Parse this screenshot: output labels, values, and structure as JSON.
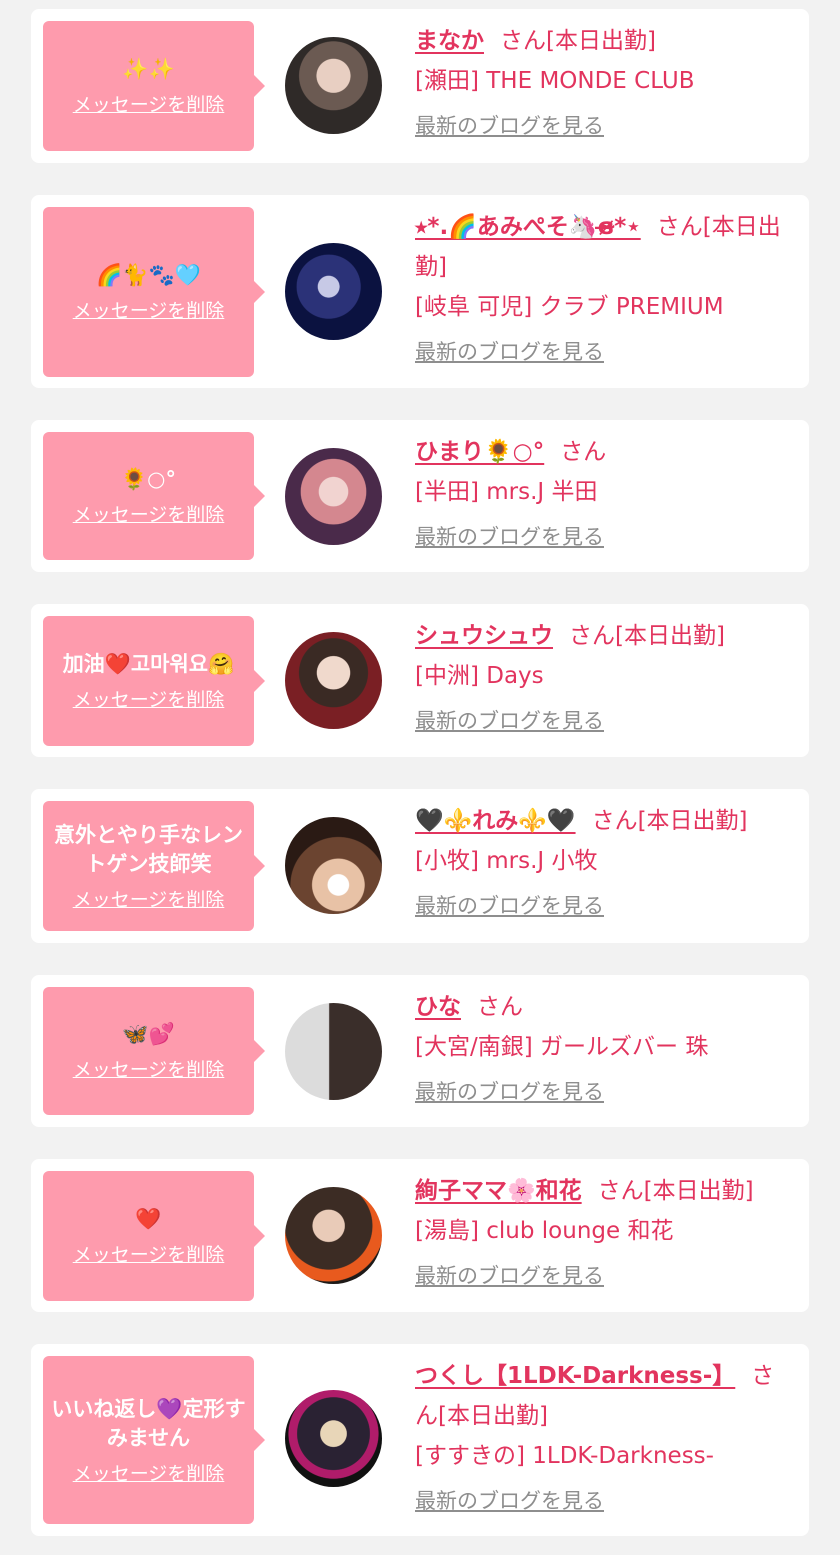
{
  "common": {
    "delete_label": "メッセージを削除",
    "blog_label": "最新のブログを見る",
    "san": "さん"
  },
  "colors": {
    "bubble": "#fe9bad",
    "accent": "#e2345e",
    "link_gray": "#8e8e8e",
    "card_bg": "#ffffff",
    "page_bg": "#f2f2f2"
  },
  "cards": [
    {
      "message": "✨✨",
      "name": "まなか",
      "status": "[本日出勤]",
      "shop": "[瀬田] THE MONDE CLUB"
    },
    {
      "message": "🌈🐈🐾🩵",
      "name": "⭑*.🌈あみぺそ🦄ɞ̴̶̷*⋆",
      "status": "[本日出勤]",
      "shop": "[岐阜 可児] クラブ PREMIUM"
    },
    {
      "message": "🌻○°",
      "name": "ひまり🌻○°",
      "status": "",
      "shop": "[半田] mrs.J 半田"
    },
    {
      "message": "加油❤️고마워요🤗",
      "name": "シュウシュウ",
      "status": "[本日出勤]",
      "shop": "[中洲] Days"
    },
    {
      "message": "意外とやり手なレントゲン技師笑",
      "name": "🖤⚜️れみ⚜️🖤",
      "status": "[本日出勤]",
      "shop": "[小牧] mrs.J 小牧"
    },
    {
      "message": "🦋💕",
      "name": "ひな",
      "status": "",
      "shop": "[大宮/南銀] ガールズバー 珠"
    },
    {
      "message": "❤️",
      "name": "絢子ママ🌸和花",
      "status": "[本日出勤]",
      "shop": "[湯島] club lounge 和花"
    },
    {
      "message": "いいね返し💜定形すみません",
      "name": "つくし【1LDK-Darkness-】",
      "status": "[本日出勤]",
      "shop": "[すすきの] 1LDK-Darkness-"
    }
  ]
}
